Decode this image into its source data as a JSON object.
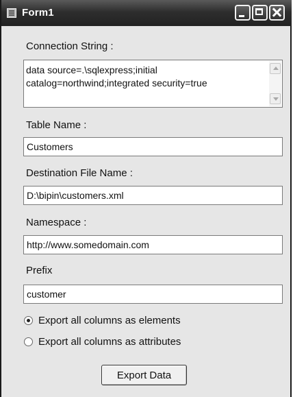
{
  "window": {
    "title": "Form1"
  },
  "form": {
    "connection_label": "Connection String :",
    "connection_value": "data source=.\\sqlexpress;initial\ncatalog=northwind;integrated security=true",
    "table_label": "Table Name :",
    "table_value": "Customers",
    "dest_label": "Destination File Name :",
    "dest_value": "D:\\bipin\\customers.xml",
    "namespace_label": "Namespace :",
    "namespace_value": "http://www.somedomain.com",
    "prefix_label": "Prefix",
    "prefix_value": "customer"
  },
  "options": {
    "elements_label": "Export all columns as elements",
    "attributes_label": "Export all columns as attributes",
    "selected": "elements"
  },
  "actions": {
    "export_label": "Export Data"
  },
  "icons": [
    "form-app-icon",
    "minimize-icon",
    "maximize-icon",
    "close-icon",
    "scroll-up-arrow-icon",
    "scroll-down-arrow-icon"
  ]
}
